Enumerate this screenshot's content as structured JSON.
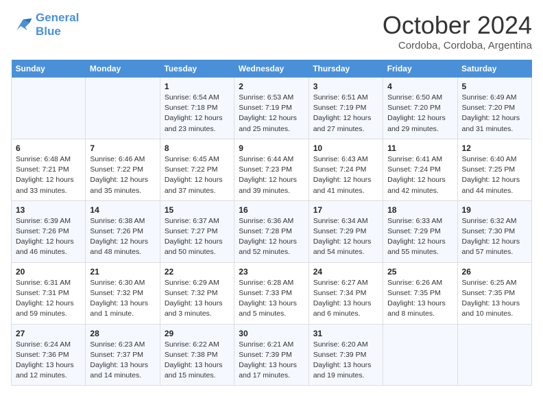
{
  "header": {
    "logo_line1": "General",
    "logo_line2": "Blue",
    "month": "October 2024",
    "location": "Cordoba, Cordoba, Argentina"
  },
  "days_of_week": [
    "Sunday",
    "Monday",
    "Tuesday",
    "Wednesday",
    "Thursday",
    "Friday",
    "Saturday"
  ],
  "weeks": [
    [
      {
        "day": "",
        "info": ""
      },
      {
        "day": "",
        "info": ""
      },
      {
        "day": "1",
        "sunrise": "6:54 AM",
        "sunset": "7:18 PM",
        "daylight": "12 hours and 23 minutes."
      },
      {
        "day": "2",
        "sunrise": "6:53 AM",
        "sunset": "7:19 PM",
        "daylight": "12 hours and 25 minutes."
      },
      {
        "day": "3",
        "sunrise": "6:51 AM",
        "sunset": "7:19 PM",
        "daylight": "12 hours and 27 minutes."
      },
      {
        "day": "4",
        "sunrise": "6:50 AM",
        "sunset": "7:20 PM",
        "daylight": "12 hours and 29 minutes."
      },
      {
        "day": "5",
        "sunrise": "6:49 AM",
        "sunset": "7:20 PM",
        "daylight": "12 hours and 31 minutes."
      }
    ],
    [
      {
        "day": "6",
        "sunrise": "6:48 AM",
        "sunset": "7:21 PM",
        "daylight": "12 hours and 33 minutes."
      },
      {
        "day": "7",
        "sunrise": "6:46 AM",
        "sunset": "7:22 PM",
        "daylight": "12 hours and 35 minutes."
      },
      {
        "day": "8",
        "sunrise": "6:45 AM",
        "sunset": "7:22 PM",
        "daylight": "12 hours and 37 minutes."
      },
      {
        "day": "9",
        "sunrise": "6:44 AM",
        "sunset": "7:23 PM",
        "daylight": "12 hours and 39 minutes."
      },
      {
        "day": "10",
        "sunrise": "6:43 AM",
        "sunset": "7:24 PM",
        "daylight": "12 hours and 41 minutes."
      },
      {
        "day": "11",
        "sunrise": "6:41 AM",
        "sunset": "7:24 PM",
        "daylight": "12 hours and 42 minutes."
      },
      {
        "day": "12",
        "sunrise": "6:40 AM",
        "sunset": "7:25 PM",
        "daylight": "12 hours and 44 minutes."
      }
    ],
    [
      {
        "day": "13",
        "sunrise": "6:39 AM",
        "sunset": "7:26 PM",
        "daylight": "12 hours and 46 minutes."
      },
      {
        "day": "14",
        "sunrise": "6:38 AM",
        "sunset": "7:26 PM",
        "daylight": "12 hours and 48 minutes."
      },
      {
        "day": "15",
        "sunrise": "6:37 AM",
        "sunset": "7:27 PM",
        "daylight": "12 hours and 50 minutes."
      },
      {
        "day": "16",
        "sunrise": "6:36 AM",
        "sunset": "7:28 PM",
        "daylight": "12 hours and 52 minutes."
      },
      {
        "day": "17",
        "sunrise": "6:34 AM",
        "sunset": "7:29 PM",
        "daylight": "12 hours and 54 minutes."
      },
      {
        "day": "18",
        "sunrise": "6:33 AM",
        "sunset": "7:29 PM",
        "daylight": "12 hours and 55 minutes."
      },
      {
        "day": "19",
        "sunrise": "6:32 AM",
        "sunset": "7:30 PM",
        "daylight": "12 hours and 57 minutes."
      }
    ],
    [
      {
        "day": "20",
        "sunrise": "6:31 AM",
        "sunset": "7:31 PM",
        "daylight": "12 hours and 59 minutes."
      },
      {
        "day": "21",
        "sunrise": "6:30 AM",
        "sunset": "7:32 PM",
        "daylight": "13 hours and 1 minute."
      },
      {
        "day": "22",
        "sunrise": "6:29 AM",
        "sunset": "7:32 PM",
        "daylight": "13 hours and 3 minutes."
      },
      {
        "day": "23",
        "sunrise": "6:28 AM",
        "sunset": "7:33 PM",
        "daylight": "13 hours and 5 minutes."
      },
      {
        "day": "24",
        "sunrise": "6:27 AM",
        "sunset": "7:34 PM",
        "daylight": "13 hours and 6 minutes."
      },
      {
        "day": "25",
        "sunrise": "6:26 AM",
        "sunset": "7:35 PM",
        "daylight": "13 hours and 8 minutes."
      },
      {
        "day": "26",
        "sunrise": "6:25 AM",
        "sunset": "7:35 PM",
        "daylight": "13 hours and 10 minutes."
      }
    ],
    [
      {
        "day": "27",
        "sunrise": "6:24 AM",
        "sunset": "7:36 PM",
        "daylight": "13 hours and 12 minutes."
      },
      {
        "day": "28",
        "sunrise": "6:23 AM",
        "sunset": "7:37 PM",
        "daylight": "13 hours and 14 minutes."
      },
      {
        "day": "29",
        "sunrise": "6:22 AM",
        "sunset": "7:38 PM",
        "daylight": "13 hours and 15 minutes."
      },
      {
        "day": "30",
        "sunrise": "6:21 AM",
        "sunset": "7:39 PM",
        "daylight": "13 hours and 17 minutes."
      },
      {
        "day": "31",
        "sunrise": "6:20 AM",
        "sunset": "7:39 PM",
        "daylight": "13 hours and 19 minutes."
      },
      {
        "day": "",
        "info": ""
      },
      {
        "day": "",
        "info": ""
      }
    ]
  ]
}
